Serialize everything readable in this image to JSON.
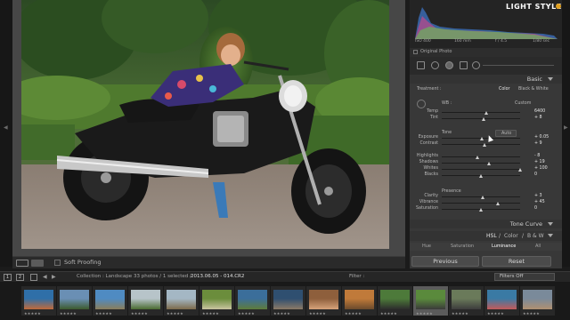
{
  "app": {
    "logo_text": "LIGHT STYLE"
  },
  "histogram": {
    "iso": "ISO 400",
    "focal": "160 mm",
    "aperture": "f / 4.5",
    "shutter": "1/80 sec",
    "original_photo": "Original Photo"
  },
  "basic": {
    "header": "Basic",
    "treatment_label": "Treatment :",
    "treatment_color": "Color",
    "treatment_bw": "Black & White",
    "wb_label": "WB :",
    "wb_value": "Custom",
    "tone_label": "Tone",
    "auto_label": "Auto",
    "presence_label": "Presence",
    "sliders": [
      {
        "label": "Temp",
        "value": "6400",
        "level": 0.57
      },
      {
        "label": "Tint",
        "value": "+ 8",
        "level": 0.53
      },
      {
        "label": "Exposure",
        "value": "+ 0.05",
        "level": 0.51
      },
      {
        "label": "Contrast",
        "value": "+ 9",
        "level": 0.55
      },
      {
        "label": "Highlights",
        "value": "- 8",
        "level": 0.46
      },
      {
        "label": "Shadows",
        "value": "+ 19",
        "level": 0.6
      },
      {
        "label": "Whites",
        "value": "+ 100",
        "level": 1.0
      },
      {
        "label": "Blacks",
        "value": "0",
        "level": 0.5
      },
      {
        "label": "Clarity",
        "value": "+ 3",
        "level": 0.52
      },
      {
        "label": "Vibrance",
        "value": "+ 45",
        "level": 0.72
      },
      {
        "label": "Saturation",
        "value": "0",
        "level": 0.5
      }
    ]
  },
  "tone_curve": {
    "header": "Tone Curve"
  },
  "hsl": {
    "hsl": "HSL",
    "color": "Color",
    "bw": "B & W",
    "tabs": [
      "Hue",
      "Saturation",
      "Luminance",
      "All"
    ],
    "active_tab": "Luminance"
  },
  "buttons": {
    "previous": "Previous",
    "reset": "Reset"
  },
  "toolbar": {
    "soft_proofing": "Soft Proofing"
  },
  "filmstrip_bar": {
    "page1": "1",
    "page2": "2",
    "collection": "Collection : Landscape",
    "count": "33 photos / 1 selected /",
    "filename": "2013.06.05 - 014.CR2",
    "filter_label": "Filter :",
    "filter_value": "Filters Off"
  },
  "filmstrip": {
    "thumbs": [
      {
        "stars": "★★★★★",
        "c1": "#2f6fa8",
        "c2": "#c26a3a"
      },
      {
        "stars": "★★★★★",
        "c1": "#6a8fb4",
        "c2": "#3c5a2c"
      },
      {
        "stars": "★★★★★",
        "c1": "#4f8bc2",
        "c2": "#8a7d5a"
      },
      {
        "stars": "★★★★★",
        "c1": "#b7c4c9",
        "c2": "#4a6a30"
      },
      {
        "stars": "★★★★★",
        "c1": "#a4b7c4",
        "c2": "#7c6a4a"
      },
      {
        "stars": "★★★★★",
        "c1": "#6b8d3c",
        "c2": "#c9c4a0"
      },
      {
        "stars": "★★★★★",
        "c1": "#3b6e9a",
        "c2": "#5f7c3a"
      },
      {
        "stars": "★★★★★",
        "c1": "#2f4f70",
        "c2": "#8c7a66"
      },
      {
        "stars": "★★★★★",
        "c1": "#8e5f3c",
        "c2": "#d6a27a"
      },
      {
        "stars": "★★★★★",
        "c1": "#c07a3a",
        "c2": "#6a4a2c"
      },
      {
        "stars": "★★★★★",
        "c1": "#4d7a3a",
        "c2": "#2c2c2c"
      },
      {
        "stars": "★★★★★",
        "c1": "#5a8a3c",
        "c2": "#3a3a3a"
      },
      {
        "stars": "★★★★★",
        "c1": "#6a7a5a",
        "c2": "#3c3c3c"
      },
      {
        "stars": "★★★★★",
        "c1": "#3a7aa4",
        "c2": "#c45a5a"
      },
      {
        "stars": "★★★★★",
        "c1": "#7a8a9a",
        "c2": "#b09070"
      }
    ],
    "selected_index": 11
  },
  "icons": {
    "eyedropper": "eyedropper-icon",
    "crop": "crop-icon",
    "spot": "spot-removal-icon",
    "redeye": "red-eye-icon",
    "graduated": "graduated-filter-icon",
    "radial": "radial-filter-icon",
    "brush": "adjustment-brush-icon"
  }
}
